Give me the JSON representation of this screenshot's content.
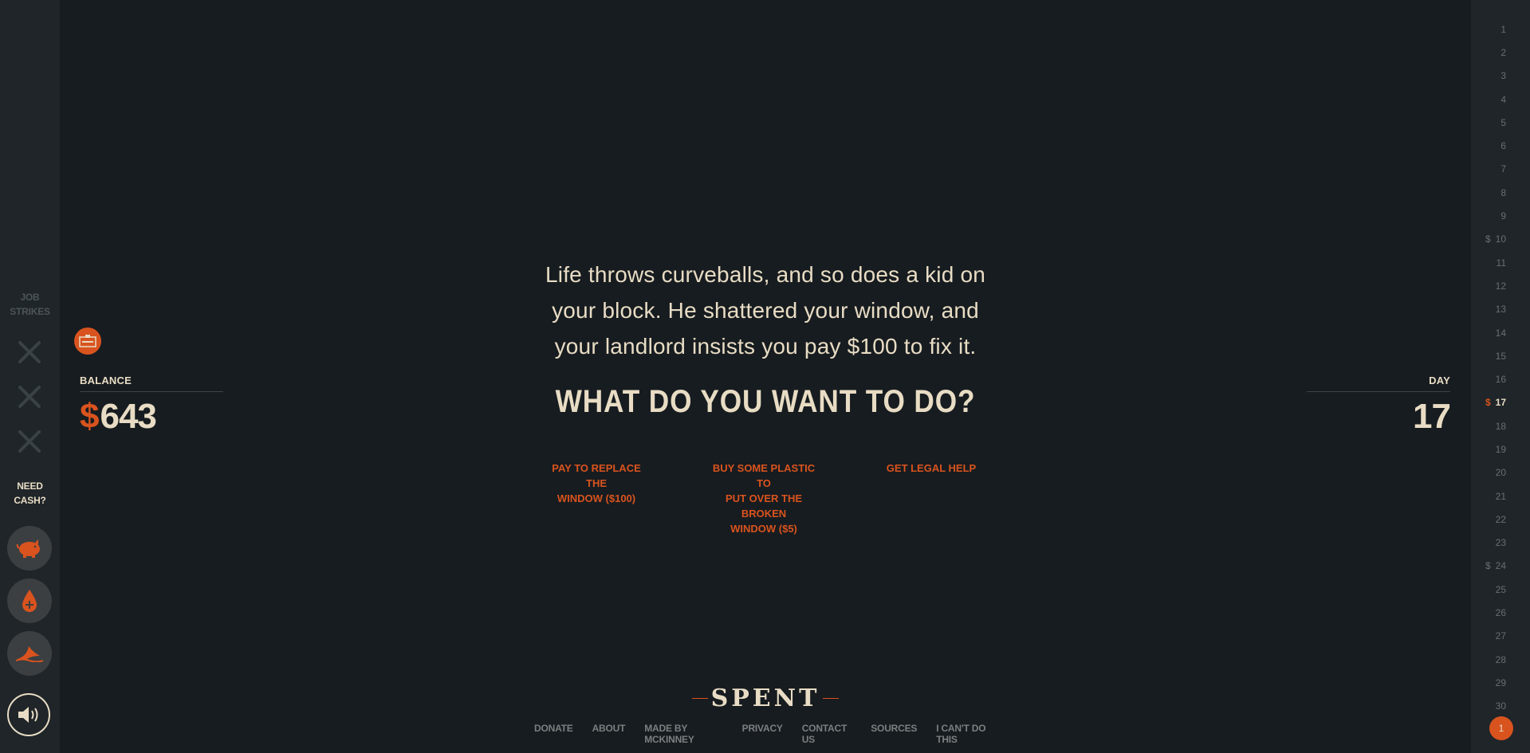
{
  "sidebar": {
    "job_strikes_label": "JOB STRIKES",
    "need_cash_label": "NEED CASH?",
    "cash_options": [
      "piggy-bank-icon",
      "blood-drop-icon",
      "shark-fin-icon"
    ]
  },
  "balance": {
    "label": "BALANCE",
    "currency": "$",
    "amount": "643"
  },
  "day": {
    "label": "DAY",
    "value": "17"
  },
  "story": {
    "line1": "Life throws curveballs, and so does a kid on",
    "line2": "your block. He shattered your window, and",
    "line3": "your landlord insists you pay $100 to fix it."
  },
  "question": "WHAT DO YOU WANT TO DO?",
  "choices": [
    {
      "line1": "PAY TO REPLACE THE",
      "line2": "WINDOW ($100)"
    },
    {
      "line1": "BUY SOME PLASTIC TO",
      "line2": "PUT OVER THE BROKEN",
      "line3": "WINDOW ($5)"
    },
    {
      "line1": "GET LEGAL HELP"
    }
  ],
  "logo": "SPENT",
  "footer": [
    "DONATE",
    "ABOUT",
    "MADE BY MCKINNEY",
    "PRIVACY",
    "CONTACT US",
    "SOURCES",
    "I CAN'T DO THIS"
  ],
  "calendar": {
    "days": [
      "1",
      "2",
      "3",
      "4",
      "5",
      "6",
      "7",
      "8",
      "9",
      "10",
      "11",
      "12",
      "13",
      "14",
      "15",
      "16",
      "17",
      "18",
      "19",
      "20",
      "21",
      "22",
      "23",
      "24",
      "25",
      "26",
      "27",
      "28",
      "29",
      "30"
    ],
    "pay_mark": "$",
    "current_day": "17",
    "month": "1"
  },
  "colors": {
    "background": "#171c20",
    "rail": "#1f2529",
    "accent": "#d9531e",
    "text": "#e8dcc4"
  }
}
